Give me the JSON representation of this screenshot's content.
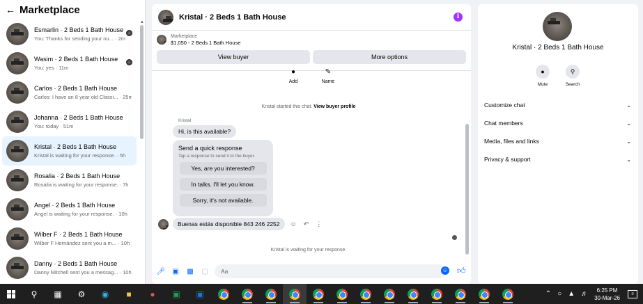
{
  "sidebar": {
    "title": "Marketplace",
    "conversations": [
      {
        "name": "Esmarlin · 2 Beds 1 Bath House",
        "preview": "You: Thanks for sending your nu... · 2m",
        "active": false,
        "dot": true
      },
      {
        "name": "Wasim · 2 Beds 1 Bath House",
        "preview": "You: yes · 11m",
        "active": false,
        "dot": true
      },
      {
        "name": "Carlos · 2 Beds 1 Bath House",
        "preview": "Carlos: I have an 8 year old Classi... · 25m",
        "active": false,
        "dot": false
      },
      {
        "name": "Johanna · 2 Beds 1 Bath House",
        "preview": "You: today · 51m",
        "active": false,
        "dot": false
      },
      {
        "name": "Kristal · 2 Beds 1 Bath House",
        "preview": "Kristal is waiting for your response. · 5h",
        "active": true,
        "dot": false
      },
      {
        "name": "Rosalia · 2 Beds 1 Bath House",
        "preview": "Rosalia is waiting for your response. · 7h",
        "active": false,
        "dot": false
      },
      {
        "name": "Angel · 2 Beds 1 Bath House",
        "preview": "Angel is waiting for your response. · 10h",
        "active": false,
        "dot": false
      },
      {
        "name": "Wilber F · 2 Beds 1 Bath House",
        "preview": "Wilber F Hernández sent you a m... · 10h",
        "active": false,
        "dot": false
      },
      {
        "name": "Danny · 2 Beds 1 Bath House",
        "preview": "Danny Mitchell sent you a messag... · 10h",
        "active": false,
        "dot": false
      }
    ]
  },
  "chat": {
    "title": "Kristal · 2 Beds 1 Bath House",
    "listing_label": "Marketplace",
    "listing_price": "$1,050 - 2 Beds 1 Bath House",
    "view_buyer": "View buyer",
    "more_options": "More options",
    "add_label": "Add",
    "name_label": "Name",
    "system_text": "Kristal started this chat.",
    "system_link": "View buyer profile",
    "sender": "Kristal",
    "msg1": "Hi, is this available?",
    "quick_title": "Send a quick response",
    "quick_sub": "Tap a response to send it to the buyer.",
    "quick_options": [
      "Yes, are you interested?",
      "In talks. I'll let you know.",
      "Sorry, it's not available."
    ],
    "msg2": "Buenas estás disponible 843 246 2252",
    "waiting": "Kristal is waiting for your response.",
    "composer_placeholder": "Aa"
  },
  "rpanel": {
    "name": "Kristal · 2 Beds 1 Bath House",
    "mute": "Mute",
    "search": "Search",
    "menu": [
      "Customize chat",
      "Chat members",
      "Media, files and links",
      "Privacy & support"
    ]
  },
  "taskbar": {
    "time": "6:25 PM",
    "date": "30-Mar-26"
  },
  "colors": {
    "accent": "#0866ff",
    "active_bg": "#e7f3ff",
    "info": "#a033ff"
  }
}
